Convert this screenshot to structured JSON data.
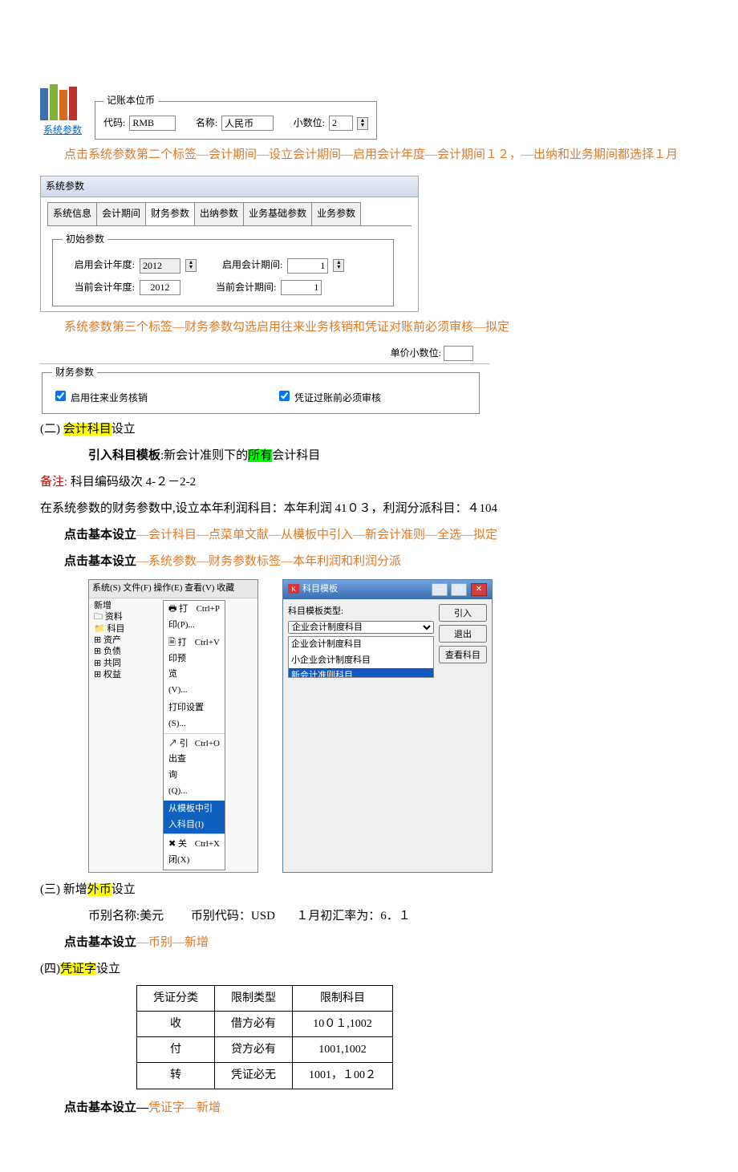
{
  "block1": {
    "link": "系统参数",
    "fieldset_legend": "记账本位币",
    "code_label": "代码:",
    "code_value": "RMB",
    "name_label": "名称:",
    "name_value": "人民币",
    "decimal_label": "小数位:",
    "decimal_value": "2"
  },
  "para1": "点击系统参数第二个标签—会计期间—设立会计期间—启用会计年度—会计期间１２，—出纳和业务期间都选择１月",
  "block2": {
    "title": "系统参数",
    "tabs": [
      "系统信息",
      "会计期间",
      "财务参数",
      "出纳参数",
      "业务基础参数",
      "业务参数"
    ],
    "active_tab_index": 2,
    "init_legend": "初始参数",
    "rows": [
      {
        "l1": "启用会计年度:",
        "v1": "2012",
        "l2": "启用会计期间:",
        "v2": "1"
      },
      {
        "l1": "当前会计年度:",
        "v1": "2012",
        "l2": "当前会计期间:",
        "v2": "1"
      }
    ]
  },
  "para2": "系统参数第三个标签—财务参数勾选启用往来业务核销和凭证对账前必须审核—拟定",
  "block3": {
    "unit_label": "单价小数位:",
    "legend": "财务参数",
    "chk1": "启用往来业务核销",
    "chk2": "凭证过账前必须审核"
  },
  "sec2": {
    "head_a": "(二)  ",
    "head_hl": "会计科目",
    "head_b": "设立",
    "intro_a": "引入科目模板",
    "intro_b": ":新会计准则下的",
    "intro_hl": "所有",
    "intro_c": "会计科目",
    "note_label": "备注:",
    "note_body": "  科目编码级次 4-２－2-2",
    "line_profit": "在系统参数的财务参数中,设立本年利润科目：本年利润 41０３，利润分派科目：４104",
    "click1_a": "点击基本设立",
    "click1_b": "—会计科目—点菜单文献—从模板中引入—新会计准则—全选—拟定",
    "click2_a": "点击基本设立",
    "click2_b": "—系统参数—财务参数标签—本年利润和利润分派"
  },
  "menu_shot": {
    "menubar": "系统(S)  文件(F)  操作(E)  查看(V)  收藏",
    "items": [
      {
        "l": "打印(P)...",
        "r": "Ctrl+P"
      },
      {
        "l": "打印预览(V)...",
        "r": "Ctrl+V"
      },
      {
        "l": "打印设置(S)...",
        "r": ""
      },
      {
        "l": "引出查询(Q)...",
        "r": "Ctrl+O"
      },
      {
        "l": "从模板中引入科目(I)",
        "r": "",
        "sel": true
      },
      {
        "l": "关闭(X)",
        "r": "Ctrl+X"
      }
    ],
    "tree": [
      "新增",
      "资料",
      "科目",
      "资产",
      "负债",
      "共同",
      "权益"
    ]
  },
  "dlg": {
    "title": "科目模板",
    "type_label": "科目模板类型:",
    "select_value": "企业会计制度科目",
    "list": [
      "企业会计制度科目",
      "小企业会计制度科目",
      "新会计准则科目"
    ],
    "sel_index": 2,
    "btns": [
      "引入",
      "退出",
      "查看科目"
    ]
  },
  "sec3": {
    "head_a": "(三) 新增",
    "head_hl": "外币",
    "head_b": "设立",
    "line1_a": "币别名称:美元",
    "line1_b": "币别代码：USD",
    "line1_c": "１月初汇率为：6．１",
    "click_a": "点击基本设立",
    "click_b": "—币别—新增"
  },
  "sec4": {
    "head_a": "(四)",
    "head_hl": "凭证字",
    "head_b": "设立",
    "table": {
      "headers": [
        "凭证分类",
        "限制类型",
        "限制科目"
      ],
      "rows": [
        [
          "收",
          "借方必有",
          "10０１,1002"
        ],
        [
          "付",
          "贷方必有",
          "1001,1002"
        ],
        [
          "转",
          "凭证必无",
          "1001，１00２"
        ]
      ]
    },
    "click_a": "点击基本设立—",
    "click_b": "凭证字—新增"
  }
}
